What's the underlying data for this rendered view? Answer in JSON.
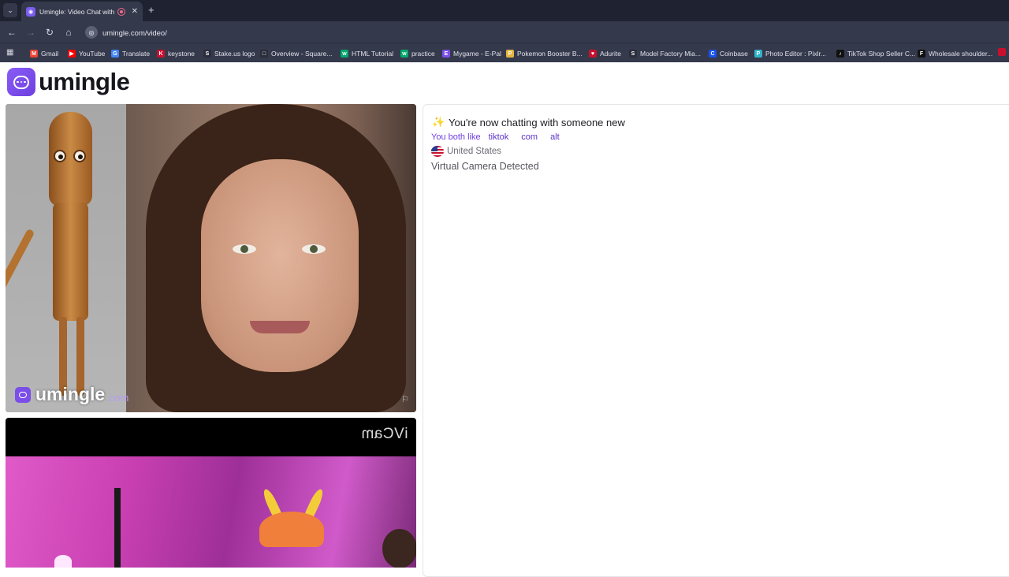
{
  "browser": {
    "tab_title": "Umingle: Video Chat with S",
    "url": "umingle.com/video/",
    "bookmarks": [
      {
        "label": "Gmail",
        "icon": "gmail-icon",
        "color": "#ea4335",
        "glyph": "M"
      },
      {
        "label": "YouTube",
        "icon": "youtube-icon",
        "color": "#ff0000",
        "glyph": "▶"
      },
      {
        "label": "Translate",
        "icon": "translate-icon",
        "color": "#4285f4",
        "glyph": "G"
      },
      {
        "label": "keystone",
        "icon": "keystone-icon",
        "color": "#c8102e",
        "glyph": "K"
      },
      {
        "label": "Stake.us logo",
        "icon": "stake-icon",
        "color": "#2a2d3a",
        "glyph": "S"
      },
      {
        "label": "Overview - Square...",
        "icon": "square-icon",
        "color": "#2a2d3a",
        "glyph": "□"
      },
      {
        "label": "HTML Tutorial",
        "icon": "w3schools-icon",
        "color": "#04aa6d",
        "glyph": "w"
      },
      {
        "label": "practice",
        "icon": "w3schools-icon",
        "color": "#04aa6d",
        "glyph": "w"
      },
      {
        "label": "Mygame - E-Pal",
        "icon": "epal-icon",
        "color": "#7b4ee8",
        "glyph": "E"
      },
      {
        "label": "Pokemon Booster B...",
        "icon": "pokemon-icon",
        "color": "#e4b542",
        "glyph": "P"
      },
      {
        "label": "Adurite",
        "icon": "adurite-icon",
        "color": "#c8102e",
        "glyph": "♥"
      },
      {
        "label": "Model Factory Mia...",
        "icon": "model-factory-icon",
        "color": "#2a2d3a",
        "glyph": "S"
      },
      {
        "label": "Coinbase",
        "icon": "coinbase-icon",
        "color": "#1652f0",
        "glyph": "C"
      },
      {
        "label": "Photo Editor : Pixlr...",
        "icon": "pixlr-icon",
        "color": "#2fb4c9",
        "glyph": "P"
      },
      {
        "label": "TikTok Shop Seller C...",
        "icon": "tiktok-icon",
        "color": "#111111",
        "glyph": "♪"
      },
      {
        "label": "Wholesale shoulder...",
        "icon": "wholesale-icon",
        "color": "#111111",
        "glyph": "F"
      }
    ]
  },
  "site": {
    "logo_text": "umingle",
    "watermark_text": "umingle",
    "watermark_suffix": ".com",
    "camera_watermark": "iVCam"
  },
  "chat": {
    "headline": "You're now chatting with someone new",
    "both_like_label": "You both like",
    "interests": [
      "tiktok",
      "com",
      "alt"
    ],
    "country": "United States",
    "notice": "Virtual Camera Detected"
  },
  "colors": {
    "brand": "#7b4ee8",
    "interest_text": "#5b32c8"
  }
}
